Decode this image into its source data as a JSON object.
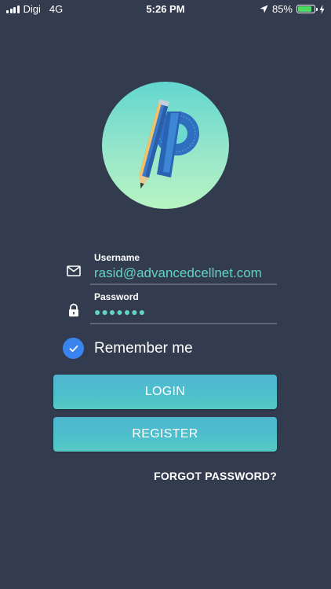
{
  "status_bar": {
    "carrier": "Digi",
    "network": "4G",
    "time": "5:26 PM",
    "battery_percent": "85%",
    "battery_level": 0.85
  },
  "login_form": {
    "username_label": "Username",
    "username_value": "rasid@advancedcellnet.com",
    "password_label": "Password",
    "password_value": "●●●●●●●",
    "remember_label": "Remember me",
    "remember_checked": true,
    "login_button": "LOGIN",
    "register_button": "REGISTER",
    "forgot_password": "FORGOT PASSWORD?"
  },
  "colors": {
    "background": "#323c4e",
    "accent_text": "#62d4c6",
    "checkbox": "#3a84f0",
    "button": "#4dbfcc"
  },
  "icons": {
    "username": "envelope-icon",
    "password": "lock-icon",
    "remember": "checkmark-icon",
    "logo": "pencil-protractor-logo"
  }
}
